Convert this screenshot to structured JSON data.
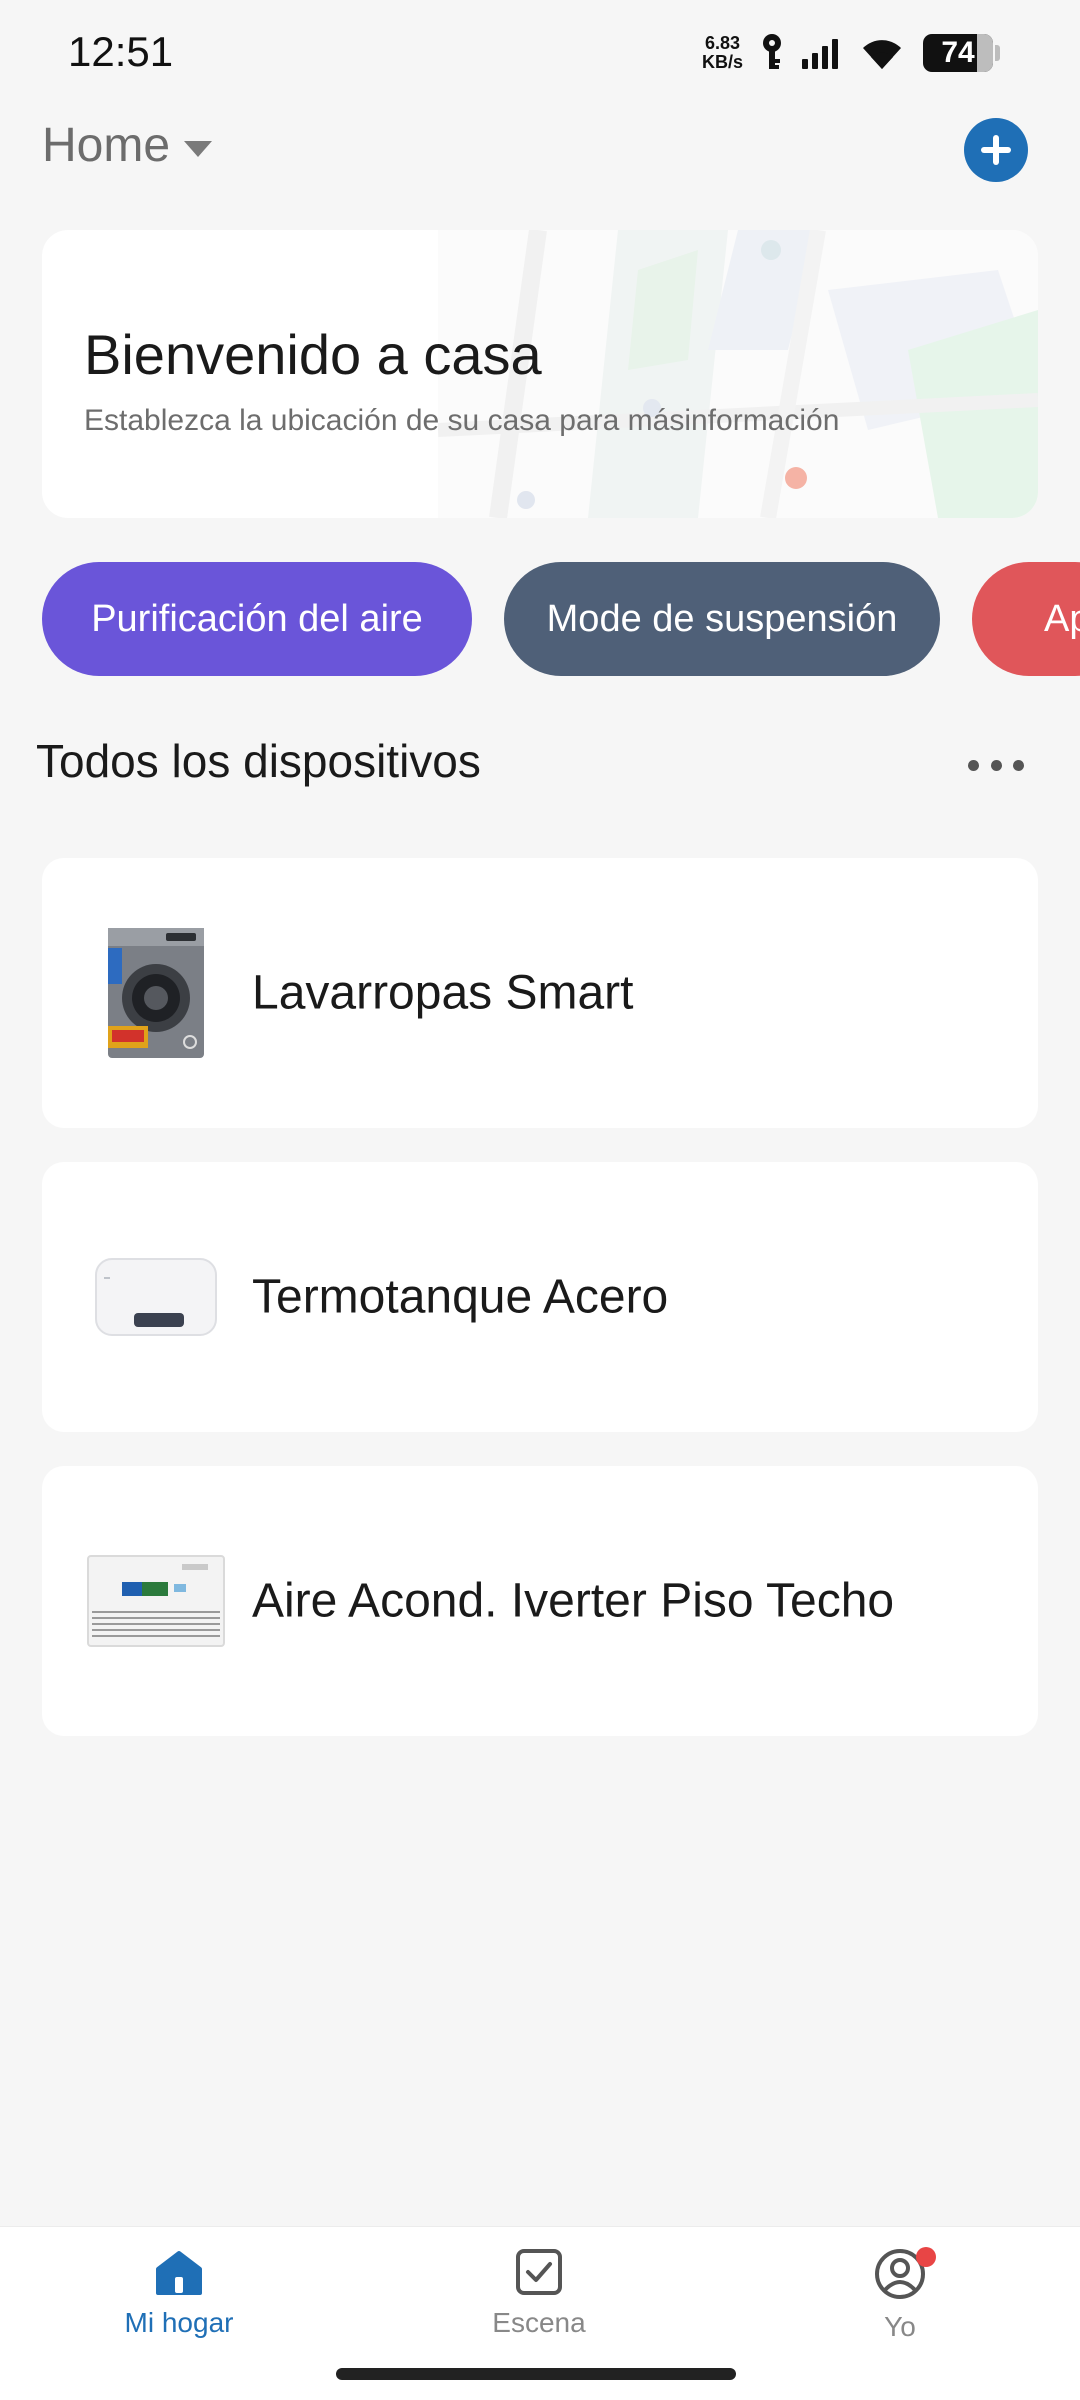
{
  "status_bar": {
    "time": "12:51",
    "net_speed_value": "6.83",
    "net_speed_unit": "KB/s",
    "battery": "74",
    "icons": [
      "key-icon",
      "signal-icon",
      "wifi-icon",
      "battery-icon"
    ]
  },
  "header": {
    "home_label": "Home",
    "add_icon": "plus-icon",
    "accent_color": "#1f6fb6"
  },
  "welcome": {
    "title": "Bienvenido a casa",
    "subtitle": "Establezca la ubicación de su casa para másinformación"
  },
  "scenes": [
    {
      "label": "Purificación del aire",
      "color": "#6a55d9"
    },
    {
      "label": "Mode de suspensión",
      "color": "#4f6078"
    },
    {
      "label": "Ap",
      "color": "#e0565a"
    }
  ],
  "devices_section": {
    "title": "Todos los dispositivos",
    "more_icon": "more-horizontal-icon"
  },
  "devices": [
    {
      "name": "Lavarropas Smart",
      "image": "washing-machine-image"
    },
    {
      "name": "Termotanque Acero",
      "image": "water-heater-image"
    },
    {
      "name": "Aire Acond. Iverter Piso Techo",
      "image": "air-conditioner-image"
    }
  ],
  "bottom_nav": {
    "items": [
      {
        "label": "Mi hogar",
        "icon": "home-icon",
        "active": true
      },
      {
        "label": "Escena",
        "icon": "checkbox-icon",
        "active": false
      },
      {
        "label": "Yo",
        "icon": "user-icon",
        "active": false,
        "badge": true
      }
    ]
  }
}
